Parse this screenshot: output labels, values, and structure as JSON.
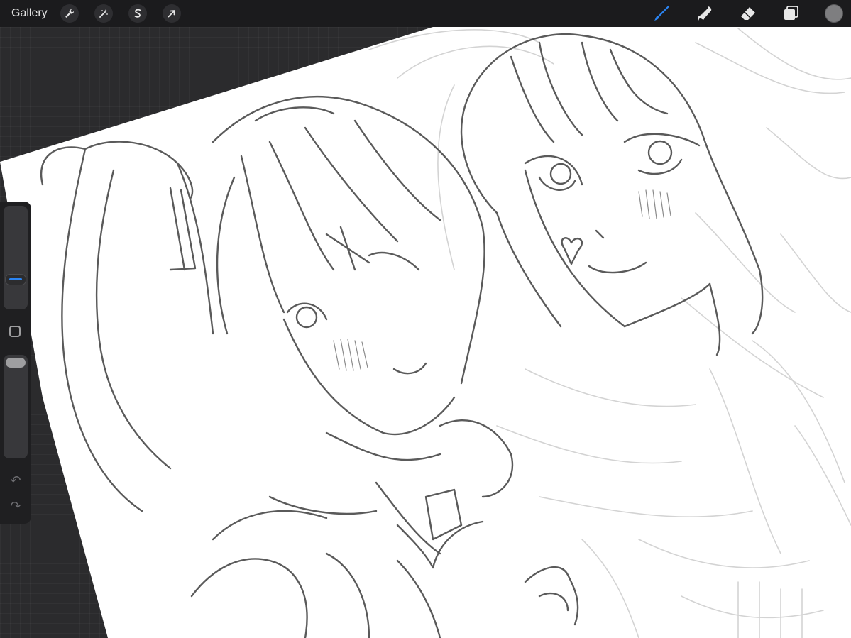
{
  "topbar": {
    "gallery_label": "Gallery",
    "left_tools": [
      {
        "name": "actions",
        "icon": "wrench-icon"
      },
      {
        "name": "adjustments",
        "icon": "magic-wand-icon"
      },
      {
        "name": "selection",
        "icon": "selection-s-icon"
      },
      {
        "name": "transform",
        "icon": "arrow-cursor-icon"
      }
    ],
    "right_tools": [
      {
        "name": "brush",
        "icon": "brush-icon",
        "active": true
      },
      {
        "name": "smudge",
        "icon": "smudge-icon",
        "active": false
      },
      {
        "name": "eraser",
        "icon": "eraser-icon",
        "active": false
      },
      {
        "name": "layers",
        "icon": "layers-icon",
        "active": false
      }
    ],
    "current_color": "#7e7e80",
    "accent_color": "#2b84f2"
  },
  "sidebar": {
    "brush_size_level": 0.25,
    "brush_opacity_level": 1.0,
    "undo_icon": "undo-icon",
    "redo_icon": "redo-icon"
  }
}
